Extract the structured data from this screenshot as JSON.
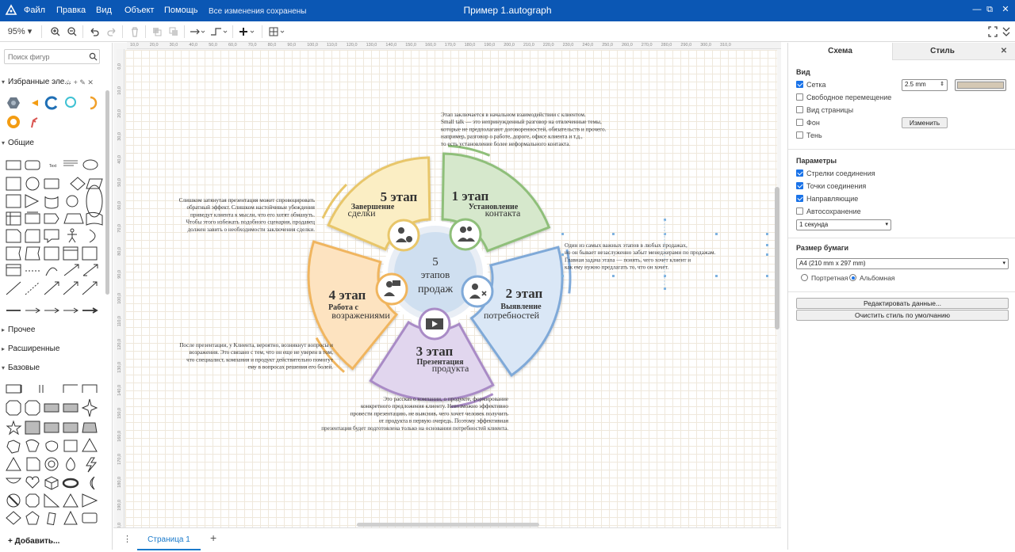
{
  "titlebar": {
    "menu": [
      "Файл",
      "Правка",
      "Вид",
      "Объект",
      "Помощь"
    ],
    "saved_status": "Все изменения сохранены",
    "window_title": "Пример 1.autograph",
    "controls": [
      "—",
      "⧉",
      "✕"
    ]
  },
  "toolbar": {
    "zoom": "95%",
    "icons": [
      "zoom-in-icon",
      "zoom-out-icon",
      "undo-icon",
      "redo-icon",
      "delete-icon",
      "to-front-icon",
      "to-back-icon",
      "connector-style-icon",
      "waypoints-icon",
      "insert-icon",
      "table-icon",
      "fullscreen-icon",
      "collapse-icon"
    ]
  },
  "left_panel": {
    "search_placeholder": "Поиск фигур",
    "favorites_title": "Избранные эле...",
    "sections": {
      "common": "Общие",
      "other": "Прочее",
      "extended": "Расширенные",
      "basic": "Базовые"
    },
    "add_more": "Добавить..."
  },
  "rulers": {
    "top": [
      "10,0",
      "20,0",
      "30,0",
      "40,0",
      "50,0",
      "60,0",
      "70,0",
      "80,0",
      "90,0",
      "100,0",
      "110,0",
      "120,0",
      "130,0",
      "140,0",
      "150,0",
      "160,0",
      "170,0",
      "180,0",
      "190,0",
      "200,0",
      "210,0",
      "220,0",
      "230,0",
      "240,0",
      "250,0",
      "260,0",
      "270,0",
      "280,0",
      "290,0",
      "300,0",
      "310,0"
    ],
    "left": [
      "0,0",
      "10,0",
      "20,0",
      "30,0",
      "40,0",
      "50,0",
      "60,0",
      "70,0",
      "80,0",
      "90,0",
      "100,0",
      "110,0",
      "120,0",
      "130,0",
      "140,0",
      "150,0",
      "160,0",
      "170,0",
      "180,0",
      "190,0",
      "200,0"
    ]
  },
  "diagram": {
    "center": {
      "number": "5",
      "line1": "этапов",
      "line2": "продаж"
    },
    "stages": [
      {
        "id": "s1",
        "stage": "1 этап",
        "title": "Установление",
        "subtitle": "контакта",
        "color": "#8fbf7a"
      },
      {
        "id": "s2",
        "stage": "2 этап",
        "title": "Выявление",
        "subtitle": "потребностей",
        "color": "#7fa9d8"
      },
      {
        "id": "s3",
        "stage": "3 этап",
        "title": "Презентация",
        "subtitle": "продукта",
        "color": "#a98bc6"
      },
      {
        "id": "s4",
        "stage": "4 этап",
        "title": "Работа с",
        "subtitle": "возражениями",
        "color": "#f0b55e"
      },
      {
        "id": "s5",
        "stage": "5 этап",
        "title": "Завершение",
        "subtitle": "сделки",
        "color": "#e8c66a"
      }
    ],
    "notes": {
      "n1": [
        "Этап заключается в начальном взаимодействии с клиентом.",
        "Small talk — это непринужденный разговор на отвлеченные темы,",
        "которые не предполагают договоренностей, обязательств и прочего.",
        "например, разговор о работе, дороге, офисе клиента и т.д.,",
        "то есть установление более неформального контакта."
      ],
      "n2": [
        "Один из самых важных этапов в любых продажах,",
        "но он бывает незаслуженно забыт менеджерами по продажам.",
        "Главная задача этапа — понять, чего хочет клиент и",
        "как ему нужно предлагать то, что он хочет."
      ],
      "n3": [
        "Это рассказ о компании, о продукте, формирование",
        "конкретного предложения клиенту. Невозможно эффективно",
        "провести презентацию, не выяснив, чего хочет человек получить",
        "от продукта в первую очередь. Поэтому эффективная",
        "презентация будет подготовлена только на основании потребностей клиента."
      ],
      "n4": [
        "После презентации, у Клиента, вероятно, возникнут вопросы и",
        "возражения. Это связано с тем, что он еще не уверен в том,",
        "что специалист, компания и продукт действительно помогут",
        "ему в вопросах решения его болей."
      ],
      "n5": [
        "Слишком затянутая презентация может спровоцировать",
        "обратный эффект. Слишком настойчивые убеждения",
        "приведут клиента к мысли, что его хотят обмануть.",
        "Чтобы этого избежать подобного сценария, продавец",
        "должен завить о необходимости заключения сделки."
      ]
    }
  },
  "pagebar": {
    "page_tab": "Страница 1",
    "add": "+"
  },
  "right_panel": {
    "tabs": [
      "Схема",
      "Стиль"
    ],
    "view": {
      "header": "Вид",
      "grid": {
        "label": "Сетка",
        "checked": true
      },
      "grid_size": "2.5 mm",
      "grid_color": "#d4c8b4",
      "free_move": {
        "label": "Свободное перемещение",
        "checked": false
      },
      "page_view": {
        "label": "Вид страницы",
        "checked": false
      },
      "background": {
        "label": "Фон",
        "checked": false
      },
      "change_btn": "Изменить",
      "shadow": {
        "label": "Тень",
        "checked": false
      }
    },
    "params": {
      "header": "Параметры",
      "items": [
        {
          "label": "Стрелки соединения",
          "checked": true
        },
        {
          "label": "Точки соединения",
          "checked": true
        },
        {
          "label": "Направляющие",
          "checked": true
        },
        {
          "label": "Автосохранение",
          "checked": false
        }
      ],
      "autosave_interval": "1 секунда"
    },
    "paper": {
      "header": "Размер бумаги",
      "size": "A4 (210 mm x 297 mm)",
      "portrait": "Портретная",
      "landscape": "Альбомная",
      "orientation": "landscape"
    },
    "edit_data_btn": "Редактировать данные...",
    "reset_style_btn": "Очистить стиль по умолчанию"
  }
}
